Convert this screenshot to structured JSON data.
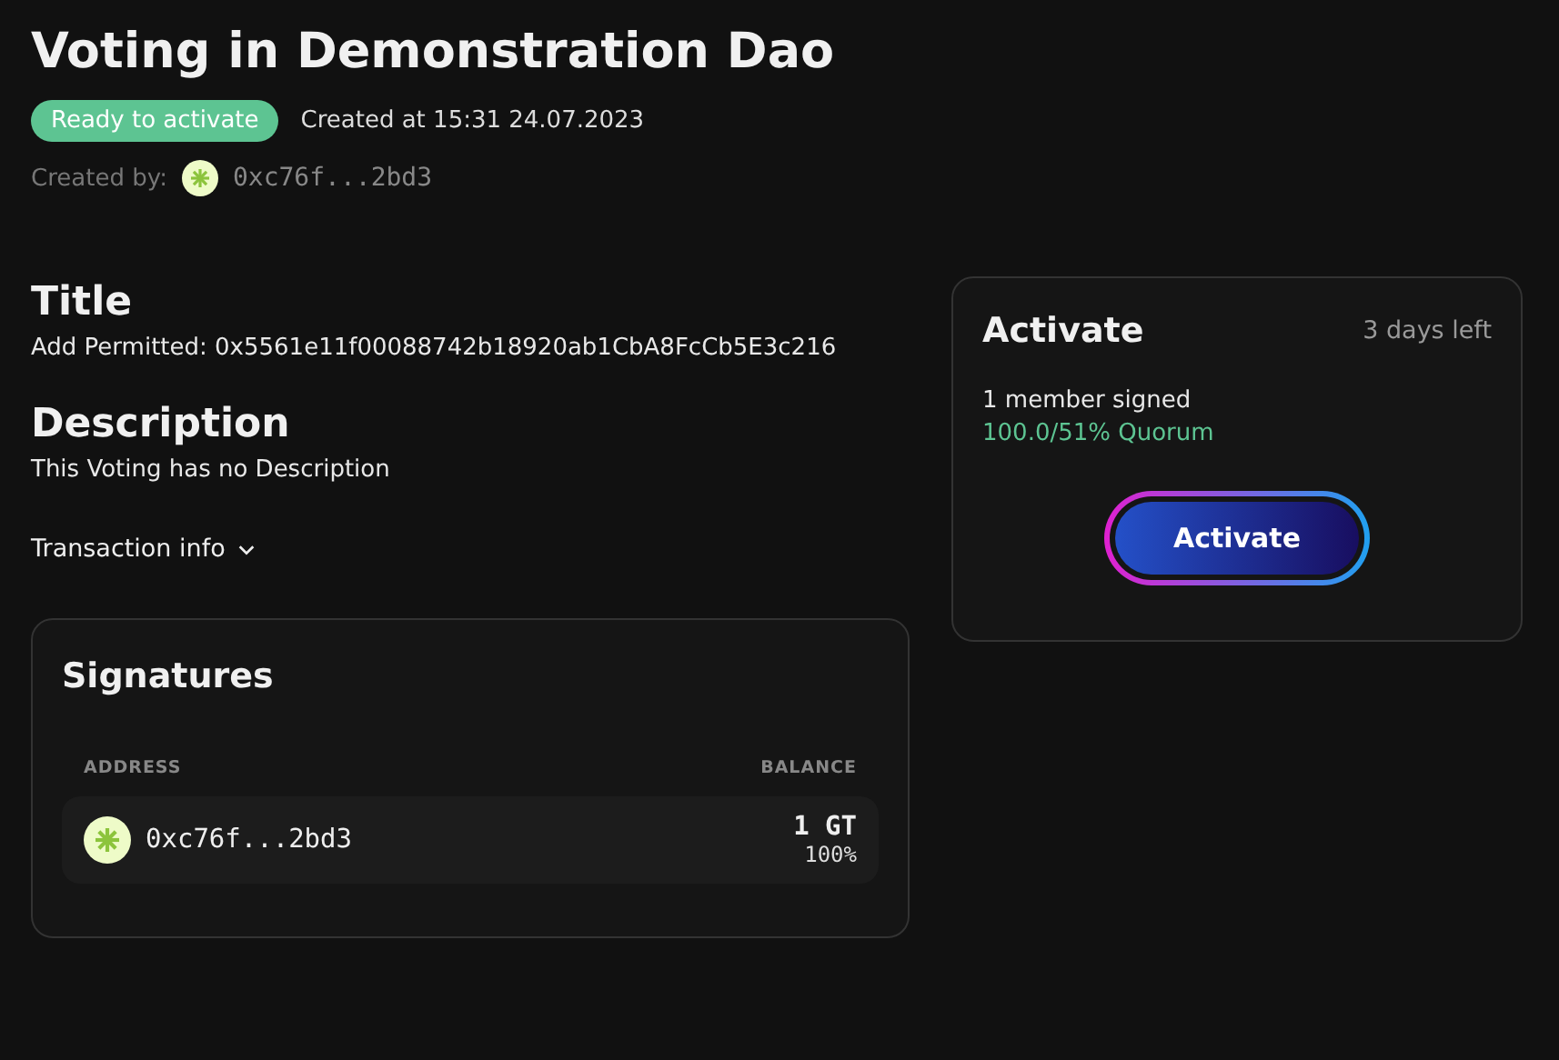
{
  "page_title": "Voting in Demonstration Dao",
  "status_badge": "Ready to activate",
  "created_at": "Created at 15:31 24.07.2023",
  "created_by": {
    "label": "Created by:",
    "address": "0xc76f...2bd3"
  },
  "title_section": {
    "heading": "Title",
    "text": "Add Permitted: 0x5561e11f00088742b18920ab1CbA8FcCb5E3c216"
  },
  "description_section": {
    "heading": "Description",
    "text": "This Voting has no Description"
  },
  "transaction_info": {
    "label": "Transaction info",
    "expanded": false
  },
  "signatures": {
    "heading": "Signatures",
    "columns": [
      "ADDRESS",
      "BALANCE"
    ],
    "rows": [
      {
        "address": "0xc76f...2bd3",
        "balance": "1 GT",
        "share": "100%"
      }
    ]
  },
  "activate_card": {
    "heading": "Activate",
    "time_left": "3 days left",
    "signed": "1 member signed",
    "quorum": "100.0/51% Quorum",
    "button": "Activate"
  }
}
